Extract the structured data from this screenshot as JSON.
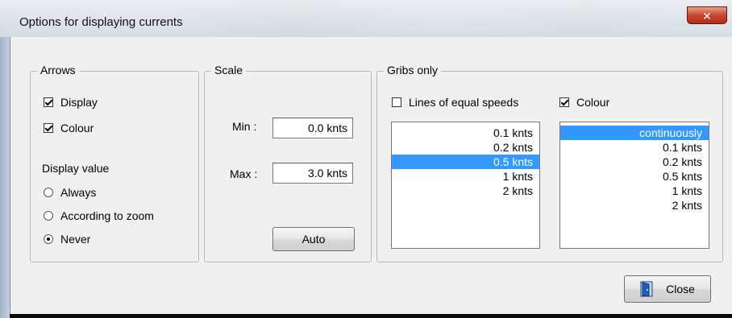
{
  "window": {
    "title": "Options for displaying currents",
    "close_glyph": "✕"
  },
  "arrows": {
    "label": "Arrows",
    "display_label": "Display",
    "display_checked": true,
    "colour_label": "Colour",
    "colour_checked": true,
    "display_value_label": "Display value",
    "options": [
      {
        "label": "Always",
        "checked": false
      },
      {
        "label": "According to zoom",
        "checked": false
      },
      {
        "label": "Never",
        "checked": true
      }
    ]
  },
  "scale": {
    "label": "Scale",
    "min_label": "Min :",
    "min_value": "0.0 knts",
    "max_label": "Max :",
    "max_value": "3.0 knts",
    "auto_label": "Auto"
  },
  "gribs": {
    "label": "Gribs only",
    "lines_label": "Lines of equal speeds",
    "lines_checked": false,
    "colour_label": "Colour",
    "colour_checked": true,
    "speed_list": [
      "0.1 knts",
      "0.2 knts",
      "0.5 knts",
      "1 knts",
      "2 knts"
    ],
    "speed_selected": "0.5 knts",
    "colour_list": [
      "continuously",
      "0.1 knts",
      "0.2 knts",
      "0.5 knts",
      "1 knts",
      "2 knts"
    ],
    "colour_selected": "continuously"
  },
  "footer": {
    "close_label": "Close",
    "close_icon": "door-exit-icon"
  },
  "colors": {
    "selection": "#3399ff",
    "dialog_bg": "#f0f0f0",
    "close_red": "#c8452e",
    "door_blue": "#1f5fbf"
  }
}
